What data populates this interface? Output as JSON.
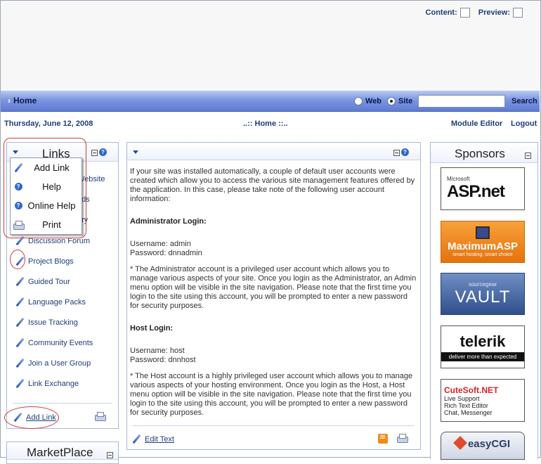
{
  "control_panel": {
    "content_label": "Content:",
    "preview_label": "Preview:"
  },
  "nav": {
    "home": "Home",
    "web": "Web",
    "site": "Site",
    "search": "Search",
    "search_value": ""
  },
  "info": {
    "date": "Thursday, June 12, 2008",
    "breadcrumb": "..:: Home ::..",
    "module_editor": "Module Editor",
    "logout": "Logout"
  },
  "links_pane": {
    "title": "Links",
    "items": [
      "Website",
      "ads",
      "ory",
      "Discussion Forum",
      "Project Blogs",
      "Guided Tour",
      "Language Packs",
      "Issue Tracking",
      "Community Events",
      "Join a User Group",
      "Link Exchange"
    ],
    "add_link": "Add Link"
  },
  "menu": {
    "items": [
      "Add Link",
      "Help",
      "Online Help",
      "Print"
    ]
  },
  "marketplace": {
    "title": "MarketPlace"
  },
  "text_pane": {
    "intro": "If your site was installed automatically, a couple of default user accounts were created which allow you to access the various site management features offered by the application. In this case, please take note of the following user account information:",
    "admin_heading": "Administrator Login:",
    "admin_user": "Username: admin",
    "admin_pass": "Password: dnnadmin",
    "admin_note": "* The Administrator account is a privileged user account which allows you to manage various aspects of your site. Once you login as the Administrator, an Admin menu option will be visible in the site navigation. Please note that the first time you login to the site using this account, you will be prompted to enter a new password for security purposes.",
    "host_heading": "Host Login:",
    "host_user": "Username: host",
    "host_pass": "Password: dnnhost",
    "host_note": "* The Host account is a highly privileged user account which allows you to manage various aspects of your hosting environment. Once you login as the Host, a Host menu option will be visible in the site navigation. Please note that the first time you login to the site using this account, you will be prompted to enter a new password for security purposes.",
    "edit_text": "Edit Text"
  },
  "sponsors": {
    "title": "Sponsors",
    "aspnet_small": "Microsoft",
    "aspnet": "ASP.net",
    "maximum": "MaximumASP",
    "maximum_tag": "smart hosting. smart choice",
    "vault_small": "sourcegear",
    "vault": "VAULT",
    "telerik": "telerik",
    "telerik_tag": "deliver more than expected",
    "cutesoft": "CuteSoft.NET",
    "cutesoft_lines": [
      "Live Support",
      "Rich Text Editor",
      "Chat, Messenger"
    ],
    "easycgi": "easyCGI"
  }
}
